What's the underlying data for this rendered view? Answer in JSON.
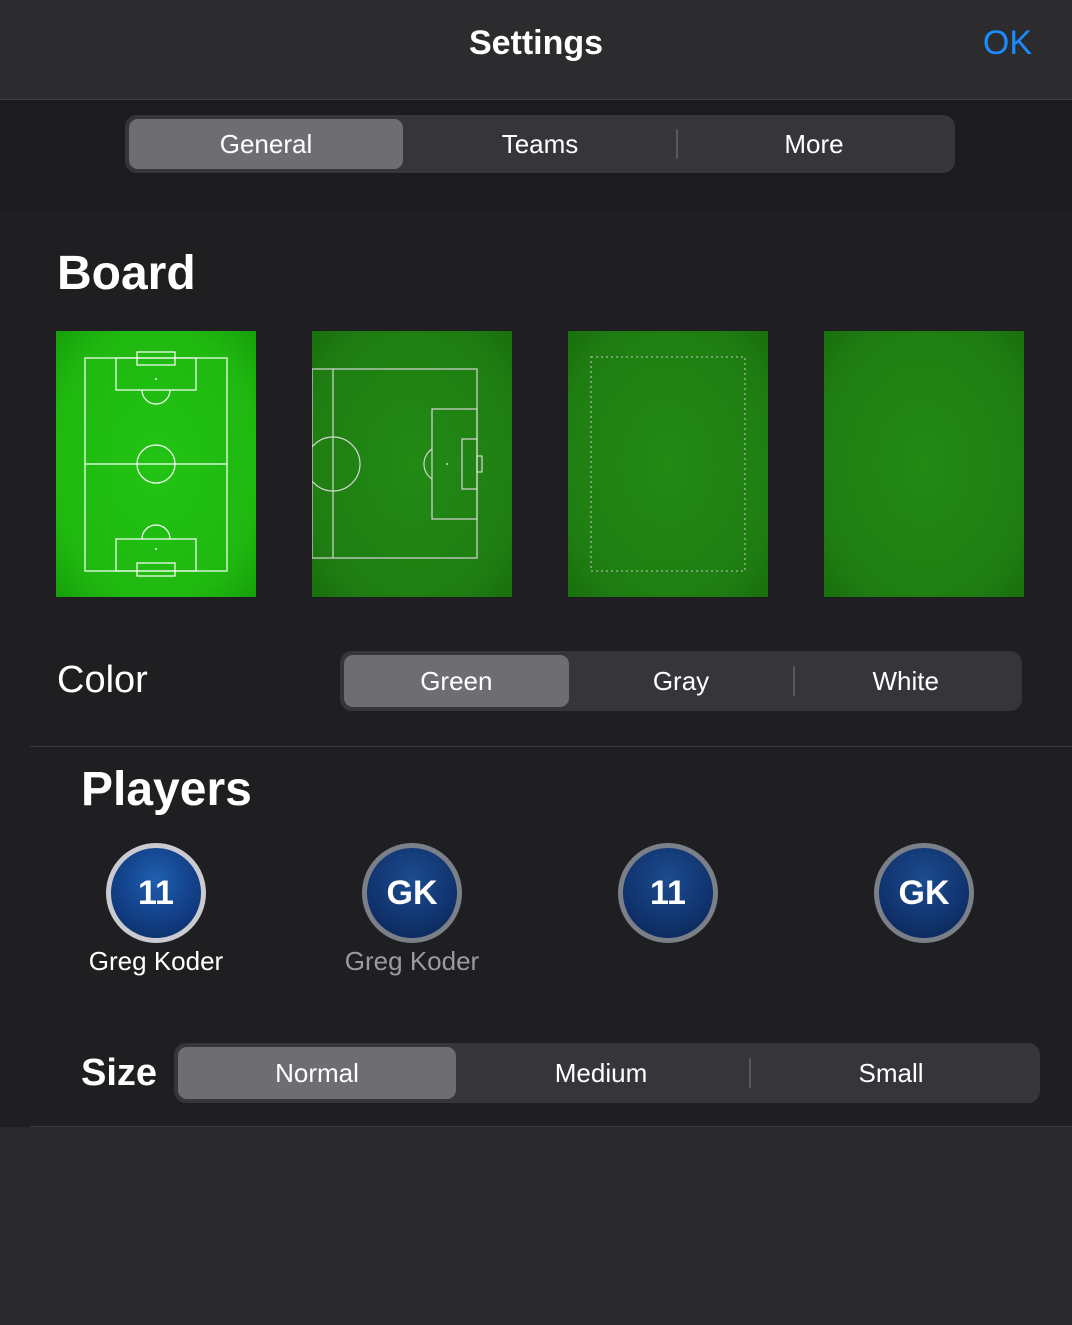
{
  "navbar": {
    "title": "Settings",
    "ok_label": "OK"
  },
  "tabs": [
    {
      "label": "General",
      "selected": true
    },
    {
      "label": "Teams",
      "selected": false
    },
    {
      "label": "More",
      "selected": false
    }
  ],
  "board": {
    "title": "Board",
    "styles": [
      "full-pitch-icon",
      "half-pitch-icon",
      "dotted-frame-icon",
      "blank-pitch-icon"
    ],
    "selected_index": 0
  },
  "color": {
    "label": "Color",
    "options": [
      {
        "label": "Green",
        "selected": true
      },
      {
        "label": "Gray",
        "selected": false
      },
      {
        "label": "White",
        "selected": false
      }
    ]
  },
  "players": {
    "title": "Players",
    "styles": [
      {
        "badge": "11",
        "name": "Greg Koder"
      },
      {
        "badge": "GK",
        "name": "Greg Koder"
      },
      {
        "badge": "11"
      },
      {
        "badge": "GK"
      }
    ]
  },
  "size": {
    "label": "Size",
    "options": [
      {
        "label": "Normal",
        "selected": true
      },
      {
        "label": "Medium",
        "selected": false
      },
      {
        "label": "Small",
        "selected": false
      }
    ]
  },
  "colors": {
    "accent": "#1b8cff",
    "pitch_selected": "#1fb80f",
    "pitch": "#1f7e12",
    "segment_selected": "#6d6d72"
  }
}
